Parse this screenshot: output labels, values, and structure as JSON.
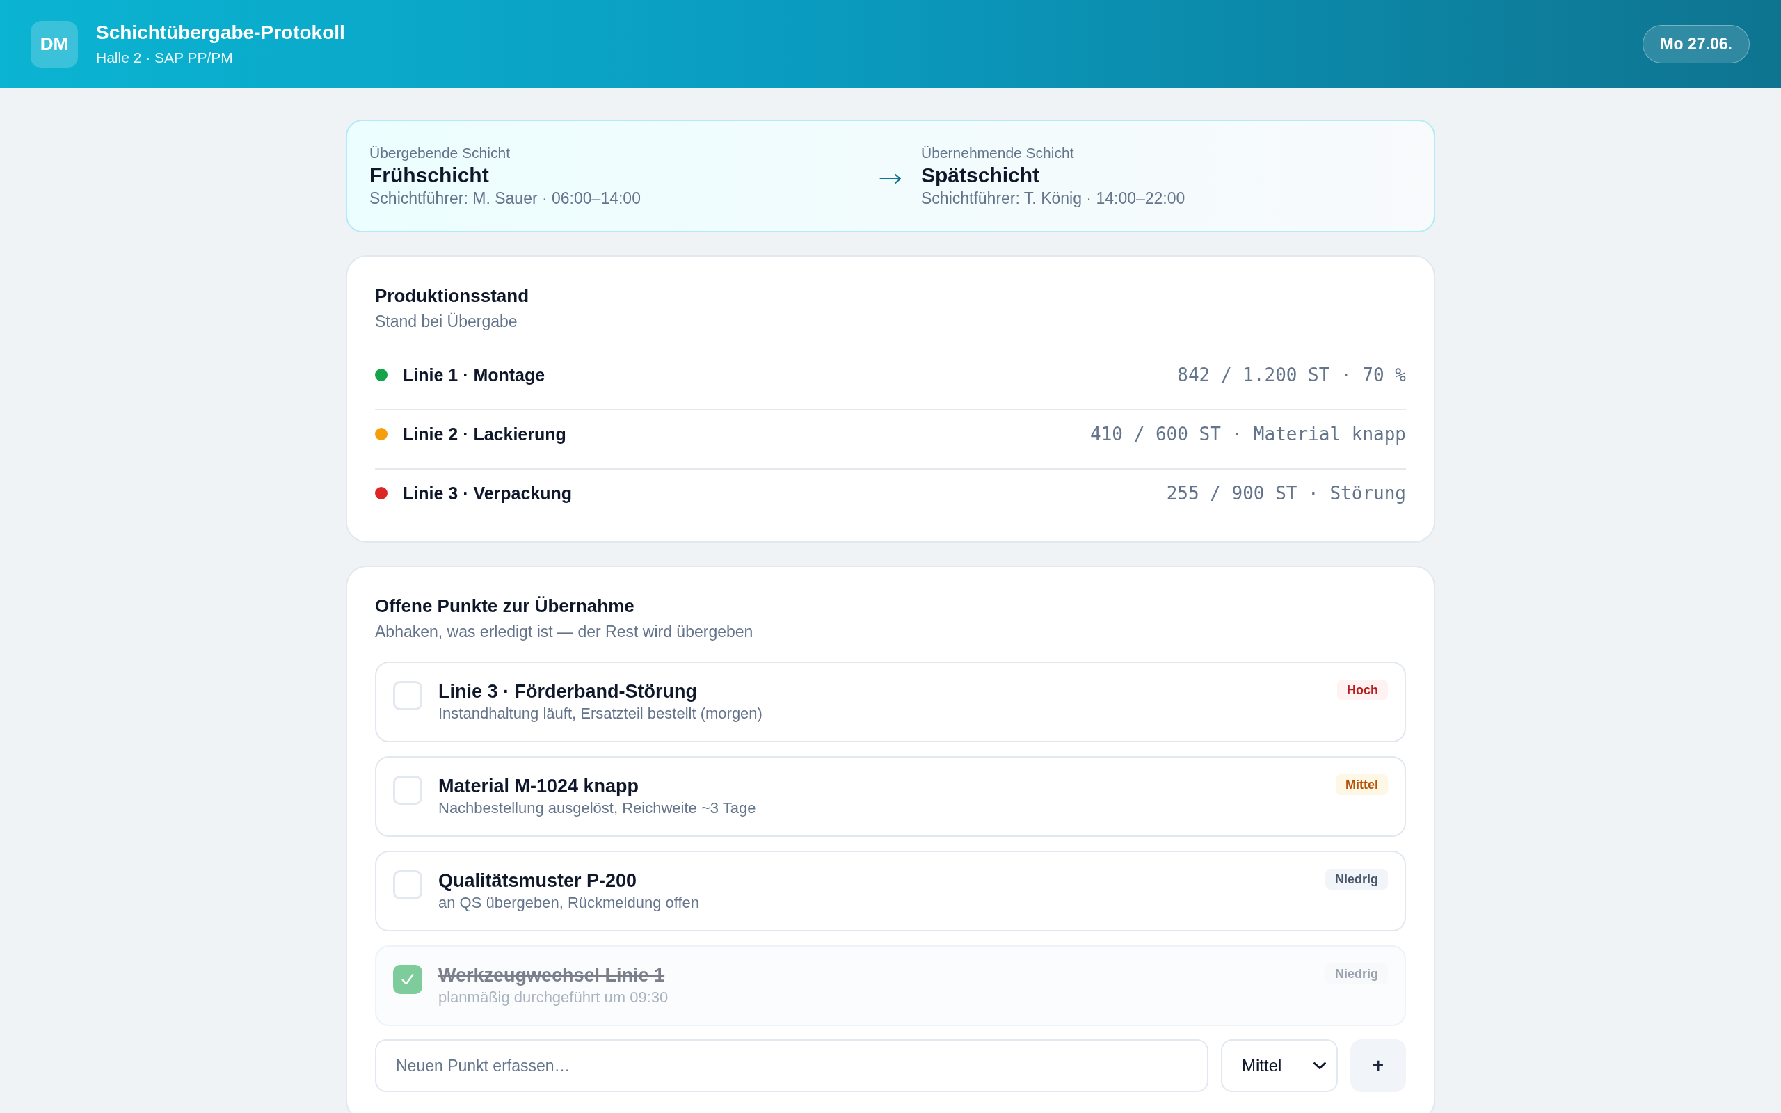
{
  "header": {
    "avatar": "DM",
    "title": "Schichtübergabe-Protokoll",
    "subtitle": "Halle 2 · SAP PP/PM",
    "date": "Mo 27.06."
  },
  "handover": {
    "outgoing": {
      "label": "Übergebende Schicht",
      "shift": "Frühschicht",
      "details": "Schichtführer: M. Sauer · 06:00–14:00"
    },
    "incoming": {
      "label": "Übernehmende Schicht",
      "shift": "Spätschicht",
      "details": "Schichtführer: T. König · 14:00–22:00"
    }
  },
  "production": {
    "title": "Produktionsstand",
    "subtitle": "Stand bei Übergabe",
    "lines": [
      {
        "name": "Linie 1 · Montage",
        "color": "#16a34a",
        "reading": "842 / 1.200 ST · 70 %"
      },
      {
        "name": "Linie 2 · Lackierung",
        "color": "#f59e0b",
        "reading": "410 / 600 ST · Material knapp"
      },
      {
        "name": "Linie 3 · Verpackung",
        "color": "#dc2626",
        "reading": "255 / 900 ST · Störung"
      }
    ]
  },
  "open_items": {
    "title": "Offene Punkte zur Übernahme",
    "subtitle": "Abhaken, was erledigt ist — der Rest wird übergeben",
    "items": [
      {
        "title": "Linie 3 · Förderband-Störung",
        "note": "Instandhaltung läuft, Ersatzteil bestellt (morgen)",
        "checked": false,
        "priority": {
          "label": "Hoch",
          "kind": "high"
        }
      },
      {
        "title": "Material M-1024 knapp",
        "note": "Nachbestellung ausgelöst, Reichweite ~3 Tage",
        "checked": false,
        "priority": {
          "label": "Mittel",
          "kind": "medium"
        }
      },
      {
        "title": "Qualitätsmuster P-200",
        "note": "an QS übergeben, Rückmeldung offen",
        "checked": false,
        "priority": {
          "label": "Niedrig",
          "kind": "low"
        }
      },
      {
        "title": "Werkzeugwechsel Linie 1",
        "note": "planmäßig durchgeführt um 09:30",
        "checked": true,
        "priority": {
          "label": "Niedrig",
          "kind": "low"
        }
      }
    ],
    "new_item": {
      "placeholder": "Neuen Punkt erfassen…",
      "priority": "Mittel",
      "add_button": "+"
    }
  }
}
